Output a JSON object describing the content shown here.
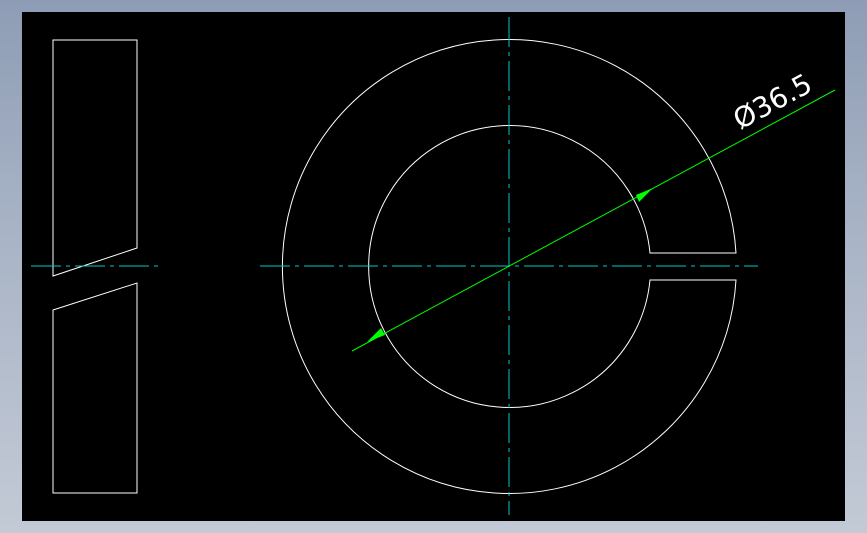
{
  "drawing": {
    "background": "#000000",
    "geometry_color": "#ffffff",
    "centerline_color": "#00c8c8",
    "dimension_color": "#00ff00",
    "dimension": {
      "label": "Ø36.5",
      "value": 36.5,
      "type": "diameter"
    }
  }
}
